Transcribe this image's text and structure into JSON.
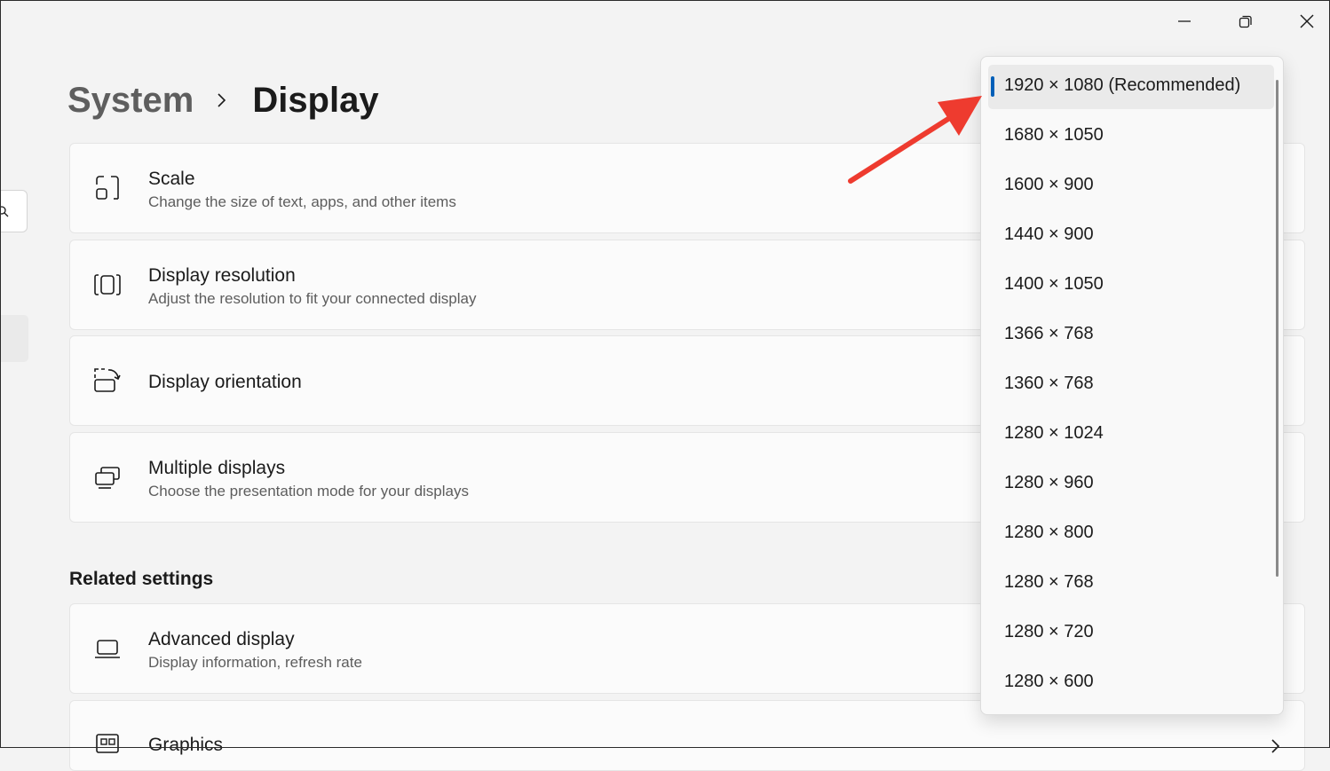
{
  "window": {
    "controls": [
      {
        "name": "minimize-icon"
      },
      {
        "name": "restore-icon"
      },
      {
        "name": "close-icon"
      }
    ]
  },
  "breadcrumb": {
    "parent": "System",
    "current": "Display"
  },
  "cards": [
    {
      "title": "Scale",
      "subtitle": "Change the size of text, apps, and other items",
      "icon": "scale-icon"
    },
    {
      "title": "Display resolution",
      "subtitle": "Adjust the resolution to fit your connected display",
      "icon": "resolution-icon"
    },
    {
      "title": "Display orientation",
      "subtitle": "",
      "icon": "orientation-icon"
    },
    {
      "title": "Multiple displays",
      "subtitle": "Choose the presentation mode for your displays",
      "icon": "multiple-displays-icon"
    }
  ],
  "related": {
    "heading": "Related settings",
    "cards": [
      {
        "title": "Advanced display",
        "subtitle": "Display information, refresh rate",
        "icon": "laptop-icon"
      },
      {
        "title": "Graphics",
        "subtitle": "",
        "icon": "graphics-icon"
      }
    ]
  },
  "resolution_dropdown": {
    "selected_index": 0,
    "options": [
      "1920 × 1080 (Recommended)",
      "1680 × 1050",
      "1600 × 900",
      "1440 × 900",
      "1400 × 1050",
      "1366 × 768",
      "1360 × 768",
      "1280 × 1024",
      "1280 × 960",
      "1280 × 800",
      "1280 × 768",
      "1280 × 720",
      "1280 × 600"
    ]
  },
  "colors": {
    "accent": "#005fb8",
    "annotation_arrow": "#ee3b2f",
    "background": "#f3f3f3",
    "card": "#fbfbfb"
  }
}
